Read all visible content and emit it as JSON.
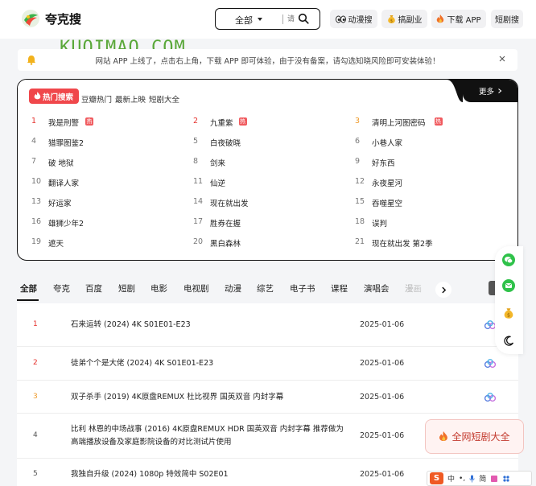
{
  "header": {
    "logo_text": "夸克搜",
    "search": {
      "category": "全部",
      "placeholder": "请"
    },
    "buttons": [
      {
        "label": "动漫搜",
        "icon": "eyes-icon"
      },
      {
        "label": "搞副业",
        "icon": "money-bag-icon"
      },
      {
        "label": "下载 APP",
        "icon": "fire-icon"
      },
      {
        "label": "短剧搜",
        "icon": ""
      }
    ]
  },
  "watermark": {
    "text": "KUQIMAO.COM"
  },
  "notice": {
    "text": "网站 APP 上线了，点击右上角，下载 APP 即可体验，由于没有备案，请勾选知晓风险即可安装体验！",
    "close_symbol": "×"
  },
  "hot": {
    "badge": "热门搜索",
    "tabs": [
      "豆瓣热门",
      "最新上映",
      "短剧大全"
    ],
    "more": "更多",
    "new_tag": "热",
    "items": [
      {
        "rank": "1",
        "title": "我是刑警",
        "tag": true
      },
      {
        "rank": "2",
        "title": "九重紫",
        "tag": true
      },
      {
        "rank": "3",
        "title": "清明上河图密码",
        "tag": true
      },
      {
        "rank": "4",
        "title": "猎罪图鉴2",
        "tag": false
      },
      {
        "rank": "5",
        "title": "白夜破晓",
        "tag": false
      },
      {
        "rank": "6",
        "title": "小巷人家",
        "tag": false
      },
      {
        "rank": "7",
        "title": "破 地狱",
        "tag": false
      },
      {
        "rank": "8",
        "title": "剑来",
        "tag": false
      },
      {
        "rank": "9",
        "title": "好东西",
        "tag": false
      },
      {
        "rank": "10",
        "title": "翻译人家",
        "tag": false
      },
      {
        "rank": "11",
        "title": "仙逆",
        "tag": false
      },
      {
        "rank": "12",
        "title": "永夜星河",
        "tag": false
      },
      {
        "rank": "13",
        "title": "好运家",
        "tag": false
      },
      {
        "rank": "14",
        "title": "现在就出发",
        "tag": false
      },
      {
        "rank": "15",
        "title": "吞噬星空",
        "tag": false
      },
      {
        "rank": "16",
        "title": "雄狮少年2",
        "tag": false
      },
      {
        "rank": "17",
        "title": "胜券在握",
        "tag": false
      },
      {
        "rank": "18",
        "title": "误判",
        "tag": false
      },
      {
        "rank": "19",
        "title": "遮天",
        "tag": false
      },
      {
        "rank": "20",
        "title": "黑白森林",
        "tag": false
      },
      {
        "rank": "21",
        "title": "现在就出发 第2季",
        "tag": false
      }
    ]
  },
  "categories": [
    "全部",
    "夸克",
    "百度",
    "短剧",
    "电影",
    "电视剧",
    "动漫",
    "综艺",
    "电子书",
    "课程",
    "演唱会",
    "漫画",
    "音"
  ],
  "results": [
    {
      "num": "1",
      "title": "石来运转 (2024) 4K S01E01-E23",
      "date": "2025-01-06"
    },
    {
      "num": "2",
      "title": "徒弟个个是大佬 (2024) 4K S01E01-E23",
      "date": "2025-01-06"
    },
    {
      "num": "3",
      "title": "双子杀手 (2019) 4K原盘REMUX 杜比视界 国英双音 内封字幕",
      "date": "2025-01-06"
    },
    {
      "num": "4",
      "title": "比利 林恩的中场战事 (2016) 4K原盘REMUX HDR 国英双音 内封字幕 推荐做为高端播放设备及家庭影院设备的对比测试片使用",
      "date": "2025-01-06"
    },
    {
      "num": "5",
      "title": "我独自升级 (2024) 1080p 特效简中 S02E01",
      "date": "2025-01-06"
    }
  ],
  "promo": {
    "label": "全网短剧大全"
  },
  "ime": {
    "logo": "S",
    "mode": "中",
    "punct": "•,",
    "lang": "简"
  },
  "colors": {
    "accent_red": "#e5302c",
    "rank3_orange": "#ee9a2a",
    "dark": "#111111"
  }
}
